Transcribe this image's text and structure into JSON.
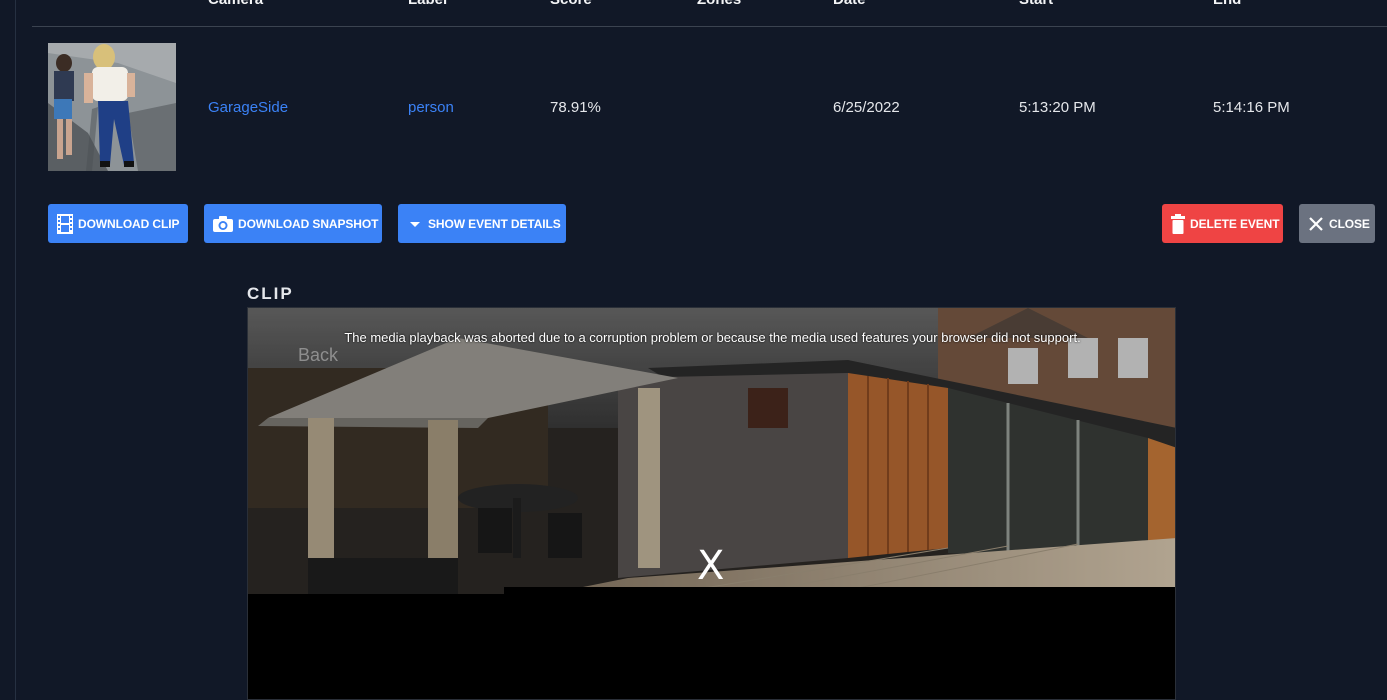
{
  "table": {
    "headers": [
      "Camera",
      "Label",
      "Score",
      "Zones",
      "Date",
      "Start",
      "End"
    ],
    "row": {
      "camera": "GarageSide",
      "label": "person",
      "score": "78.91%",
      "zones": "",
      "date": "6/25/2022",
      "start": "5:13:20 PM",
      "end": "5:14:16 PM"
    }
  },
  "actions": {
    "download_clip": "Download Clip",
    "download_snapshot": "Download Snapshot",
    "show_event_details": "Show Event Details",
    "delete_event": "Delete Event",
    "close": "Close"
  },
  "clip": {
    "title": "CLIP",
    "error_message": "The media playback was aborted due to a corruption problem or because the media used features your browser did not support.",
    "back_label": "Back",
    "close_mark": "X"
  },
  "colors": {
    "background": "#111827",
    "accent_blue": "#3b82f6",
    "danger_red": "#ef4444",
    "neutral_gray": "#6b7280"
  },
  "icons": {
    "download_clip": "film-icon",
    "download_snapshot": "camera-icon",
    "show_event_details": "caret-down-icon",
    "delete_event": "trash-icon",
    "close": "close-icon"
  }
}
